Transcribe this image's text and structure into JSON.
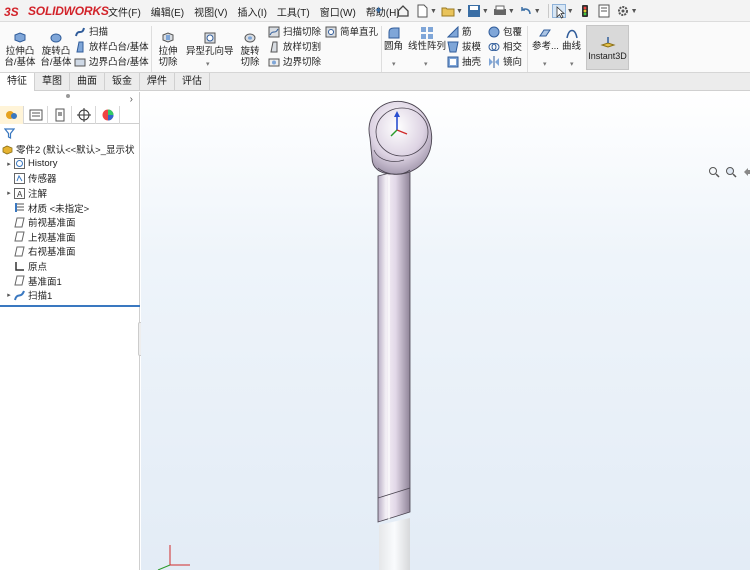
{
  "app": {
    "logo_text": "SOLIDWORKS"
  },
  "menu": [
    "文件(F)",
    "编辑(E)",
    "视图(V)",
    "插入(I)",
    "工具(T)",
    "窗口(W)",
    "帮助(H)"
  ],
  "commands": {
    "extrude_boss": "拉伸凸台/基体",
    "revolve_boss": "旋转凸台/基体",
    "sweep": "扫描",
    "loft_boss": "放样凸台/基体",
    "boundary_boss": "边界凸台/基体",
    "extrude_cut": "拉伸切除",
    "hole_wizard": "异型孔向导",
    "revolve_cut": "旋转切除",
    "swept_cut": "扫描切除",
    "lofted_cut": "放样切割",
    "boundary_cut": "边界切除",
    "simple_hole": "简单直孔",
    "fillet": "圆角",
    "linear_pattern": "线性阵列",
    "rib": "筋",
    "draft": "拔模",
    "shell": "抽壳",
    "wrap": "包覆",
    "intersect": "相交",
    "mirror": "镜向",
    "reference": "参考...",
    "curves": "曲线",
    "instant3d": "Instant3D"
  },
  "tabs": [
    "特征",
    "草图",
    "曲面",
    "钣金",
    "焊件",
    "评估"
  ],
  "active_tab": "特征",
  "tree": {
    "root": "零件2 (默认<<默认>_显示状",
    "items": [
      {
        "label": "History",
        "icon": "history-icon",
        "expandable": true
      },
      {
        "label": "传感器",
        "icon": "sensor-icon",
        "expandable": false
      },
      {
        "label": "注解",
        "icon": "annotation-icon",
        "expandable": true
      },
      {
        "label": "材质 <未指定>",
        "icon": "material-icon",
        "expandable": false
      },
      {
        "label": "前视基准面",
        "icon": "plane-icon",
        "expandable": false
      },
      {
        "label": "上视基准面",
        "icon": "plane-icon",
        "expandable": false
      },
      {
        "label": "右视基准面",
        "icon": "plane-icon",
        "expandable": false
      },
      {
        "label": "原点",
        "icon": "origin-icon",
        "expandable": false
      },
      {
        "label": "基准面1",
        "icon": "plane-icon",
        "expandable": false
      },
      {
        "label": "扫描1",
        "icon": "sweep-feature-icon",
        "expandable": true
      }
    ]
  },
  "colors": {
    "accent": "#d2232a",
    "selection": "#3a78c0",
    "part": "#d8cfe0"
  }
}
